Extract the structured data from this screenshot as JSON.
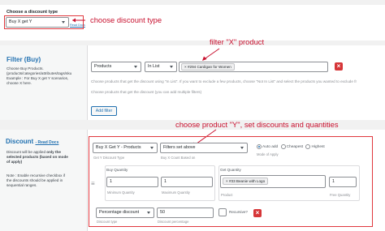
{
  "choose_discount_section": {
    "label": "Choose a discount type",
    "select_value": "Buy X get Y",
    "read_docs": "Read Docs",
    "annotation": "choose discount type"
  },
  "filter_section": {
    "title": "Filter (Buy)",
    "description": [
      "Choose Buy Products.",
      "(products/categories/attributes/tags/sku",
      "Example : For Buy X get Y scenarios,",
      "choose X here."
    ],
    "filter_type": "Products",
    "method": "In List",
    "selected_product": "#294 Cardigan for Women",
    "help_text_1": "Choose products that get the discount using \"In List\". If you want to exclude a few products, choose \"Not In List\" and select the products you wanted to exclude fr",
    "help_text_2": "Choose products that get the discount (you can add multiple filters)",
    "add_filter_label": "Add filter",
    "annotation": "filter \"X\" product"
  },
  "discount_section": {
    "title": "Discount",
    "read_docs": "- Read Docs",
    "description_lines": [
      [
        "Discount will be applied ",
        "only the"
      ],
      [
        "",
        "selected products (based on mode"
      ],
      [
        "",
        "of apply)"
      ]
    ],
    "note": [
      "Note : Enable recursive checkbox if",
      "the discounts should be applied in",
      "sequential ranges."
    ],
    "discount_type_select": "Buy X Get Y - Products",
    "discount_type_caption": "Get Y Discount Type",
    "based_on_select": "Filters set above",
    "based_on_caption": "Buy X Count Based on",
    "mode_options": [
      "Auto add",
      "Cheapest",
      "Highest"
    ],
    "mode_selected": "Auto add",
    "mode_caption": "Mode of Apply",
    "buy_quantity_label": "Buy Quantity",
    "min_qty_value": "1",
    "min_qty_caption": "Minimum Quantity",
    "max_qty_value": "1",
    "max_qty_caption": "Maximum Quantity",
    "get_quantity_label": "Get Quantity",
    "get_product": "#33 Beanie with Logo",
    "product_caption": "Product",
    "free_qty_value": "1",
    "free_qty_caption": "Free Quantity",
    "percentage_select": "Percentage discount",
    "percentage_caption": "Discount type",
    "percentage_value": "50",
    "percentage_value_caption": "Discount percentage",
    "recursive_label": "Recursive?",
    "annotation": "choose product \"Y\", set discounts and quantities"
  },
  "colors": {
    "annotation": "#c8102e",
    "accent": "#2271b1",
    "remove": "#d63638"
  }
}
